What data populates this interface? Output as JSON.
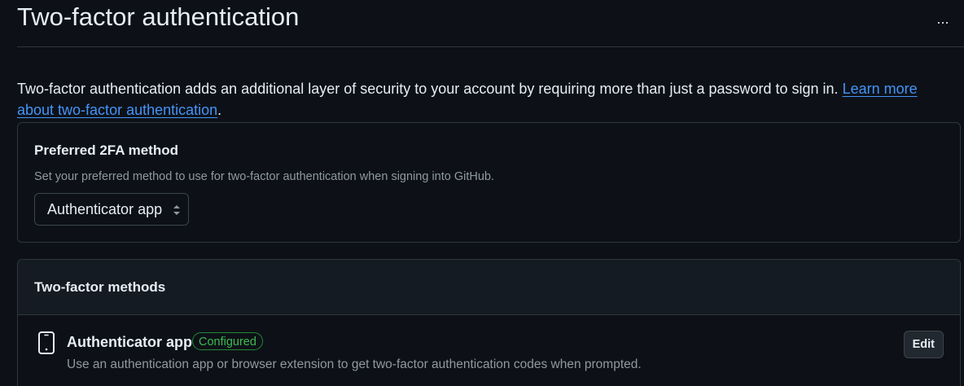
{
  "header": {
    "title": "Two-factor authentication",
    "more_label": "..."
  },
  "intro": {
    "text": "Two-factor authentication adds an additional layer of security to your account by requiring more than just a password to sign in. ",
    "link_text": "Learn more about two-factor authentication",
    "trailing": "."
  },
  "preferred": {
    "title": "Preferred 2FA method",
    "description": "Set your preferred method to use for two-factor authentication when signing into GitHub.",
    "selected": "Authenticator app"
  },
  "methods": {
    "title": "Two-factor methods",
    "items": [
      {
        "icon": "mobile-device-icon",
        "name": "Authenticator app",
        "status": "Configured",
        "description": "Use an authentication app or browser extension to get two-factor authentication codes when prompted.",
        "action_label": "Edit"
      }
    ]
  },
  "colors": {
    "background": "#0d1117",
    "border": "#30363d",
    "link": "#4493f8",
    "success": "#3fb950",
    "muted": "#9198a1"
  }
}
